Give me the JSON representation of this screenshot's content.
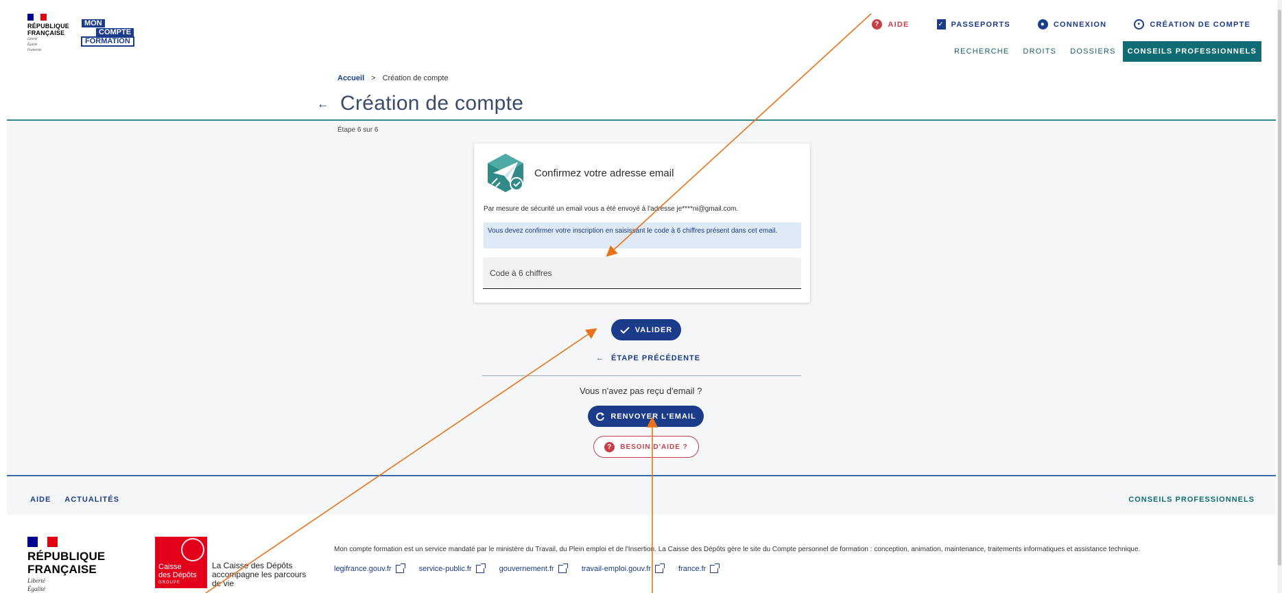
{
  "header": {
    "republique_lines": [
      "RÉPUBLIQUE",
      "FRANÇAISE"
    ],
    "republique_motto": [
      "Liberté",
      "Égalité",
      "Fraternité"
    ],
    "brand_lines": [
      "MON",
      "COMPTE",
      "FORMATION"
    ],
    "top_nav": {
      "aide": "AIDE",
      "passeports": "PASSEPORTS",
      "connexion": "CONNEXION",
      "creation": "CRÉATION DE COMPTE"
    },
    "sub_nav": {
      "recherche": "RECHERCHE",
      "droits": "DROITS",
      "dossiers": "DOSSIERS",
      "conseils": "CONSEILS PROFESSIONNELS"
    }
  },
  "breadcrumb": {
    "home": "Accueil",
    "separator": ">",
    "current": "Création de compte"
  },
  "page": {
    "back_icon": "←",
    "title": "Création de compte",
    "step": "Étape 6 sur 6"
  },
  "card": {
    "icon": "paper-plane-check-icon",
    "title": "Confirmez votre adresse email",
    "text": "Par mesure de sécurité un email vous a été envoyé à l'adresse je****ni@gmail.com.",
    "info": "Vous devez confirmer votre inscription en saisissant le code à 6 chiffres présent dans cet email.",
    "input_placeholder": "Code à 6 chiffres"
  },
  "actions": {
    "valider": "VALIDER",
    "previous": "ÉTAPE PRÉCÉDENTE",
    "no_email": "Vous n'avez pas reçu d'email ?",
    "resend": "RENVOYER L'EMAIL",
    "help": "BESOIN D'AIDE ?"
  },
  "footer": {
    "nav_left": {
      "aide": "AIDE",
      "actualites": "ACTUALITÉS"
    },
    "nav_right": "CONSEILS PROFESSIONNELS",
    "republique_lines": [
      "RÉPUBLIQUE",
      "FRANÇAISE"
    ],
    "republique_motto": [
      "Liberté",
      "Égalité"
    ],
    "cdc_logo": [
      "Caisse",
      "des Dépôts",
      "GROUPE"
    ],
    "cdc_tagline": "La Caisse des Dépôts accompagne les parcours de vie",
    "description": "Mon compte formation est un service mandaté par le ministère du Travail, du Plein emploi et de l'Insertion. La Caisse des Dépôts gère le site du Compte personnel de formation : conception, animation, maintenance, traitements informatiques et assistance technique.",
    "links": [
      "legifrance.gouv.fr",
      "service-public.fr",
      "gouvernement.fr",
      "travail-emploi.gouv.fr",
      "france.fr"
    ]
  },
  "colors": {
    "primary_blue": "#1a3c8a",
    "teal": "#0f6c74",
    "danger_red": "#c83f49",
    "annotation_orange": "#e8731a",
    "info_bg": "#deeaf6"
  }
}
